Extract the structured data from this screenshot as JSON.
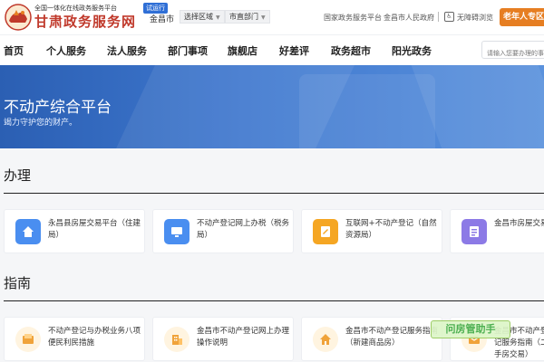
{
  "header": {
    "portal_tagline": "全国一体化在线政务服务平台",
    "site_name": "甘肃政务服务网",
    "trial_badge": "试运行",
    "city": "金昌市",
    "region_select": "选择区域",
    "dept_select": "市直部门",
    "link_national": "国家政务服务平台",
    "link_city_gov": "金昌市人民政府",
    "accessibility": "无障碍浏览",
    "elder_zone": "老年人专区"
  },
  "nav": {
    "items": [
      "首页",
      "个人服务",
      "法人服务",
      "部门事项",
      "旗舰店",
      "好差评",
      "政务超市",
      "阳光政务"
    ],
    "search_placeholder": "请输入您要办理的事项"
  },
  "banner": {
    "title": "不动产综合平台",
    "subtitle": "竭力守护您的财产。"
  },
  "banli": {
    "title": "办理",
    "cards": [
      {
        "label": "永昌县房屋交易平台（住建局）",
        "icon": "home-icon",
        "color": "#4a8ef0"
      },
      {
        "label": "不动产登记网上办税（税务局）",
        "icon": "monitor-icon",
        "color": "#4a8ef0"
      },
      {
        "label": "互联网+不动产登记（自然资源局）",
        "icon": "pen-doc-icon",
        "color": "#f5a623"
      },
      {
        "label": "金昌市房屋交易平台",
        "icon": "list-doc-icon",
        "color": "#8c7ae6"
      }
    ]
  },
  "guide": {
    "title": "指南",
    "cards": [
      {
        "label": "不动产登记与办税业务八项便民利民措施",
        "icon": "inbox-icon",
        "color": "#fff4e0"
      },
      {
        "label": "金昌市不动产登记网上办理操作说明",
        "icon": "building-icon",
        "color": "#fff4e0"
      },
      {
        "label": "金昌市不动产登记服务指南（新建商品房）",
        "icon": "house-icon",
        "color": "#fff4e0"
      },
      {
        "label": "金昌市不动产登记服务指南（二手房交易）",
        "icon": "mail-icon",
        "color": "#fff4e0"
      }
    ]
  },
  "watermark": "问房管助手"
}
